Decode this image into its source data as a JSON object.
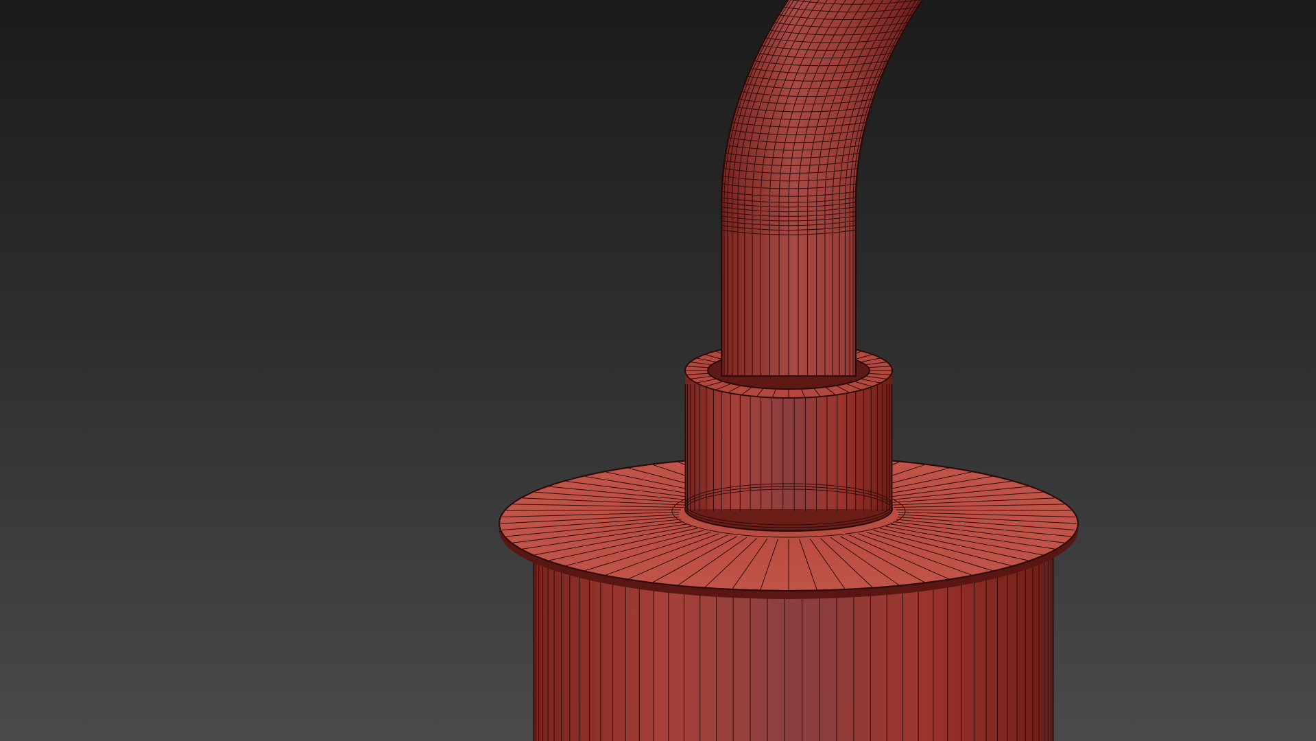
{
  "viewport": {
    "background_top": "#1b1b1b",
    "background_bottom": "#4a4a4a",
    "wire_color": "#2a0b09"
  },
  "model": {
    "base_color": "#a63a32",
    "highlight_color": "#c9564c",
    "shadow_color": "#5a1612",
    "parts": [
      {
        "name": "curved-tube"
      },
      {
        "name": "collar-ring"
      },
      {
        "name": "flange-disc"
      },
      {
        "name": "base-cylinder"
      }
    ]
  }
}
